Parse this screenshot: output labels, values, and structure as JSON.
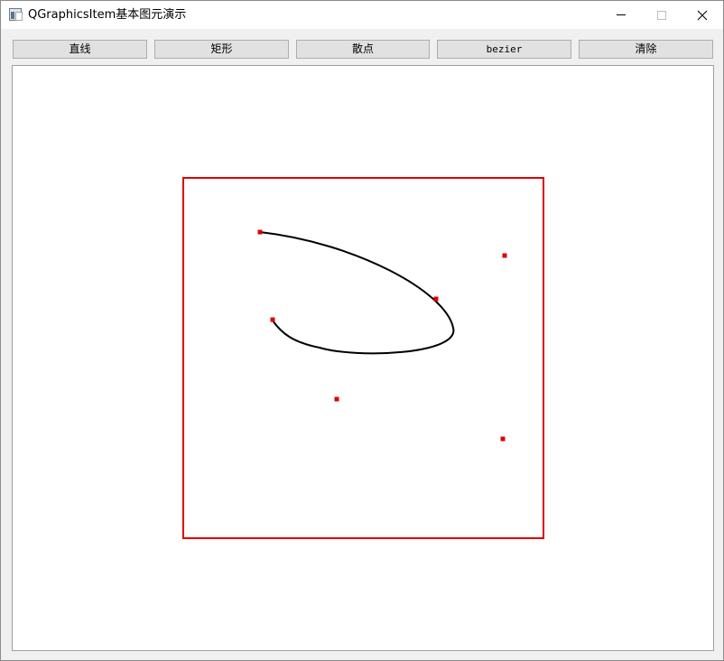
{
  "window": {
    "title": "QGraphicsItem基本图元演示",
    "controls": [
      "minimize",
      "maximize",
      "close"
    ]
  },
  "toolbar": {
    "buttons": [
      {
        "id": "line",
        "label": "直线"
      },
      {
        "id": "rect",
        "label": "矩形"
      },
      {
        "id": "scatter",
        "label": "散点"
      },
      {
        "id": "bezier",
        "label": "bezier"
      },
      {
        "id": "clear",
        "label": "清除"
      }
    ]
  },
  "scene": {
    "rect_color": "#e00000",
    "curve_color": "#000000",
    "point_color": "#e00000",
    "background": "#ffffff"
  },
  "icons": {
    "app": "app-window-icon",
    "close": "close-icon"
  }
}
